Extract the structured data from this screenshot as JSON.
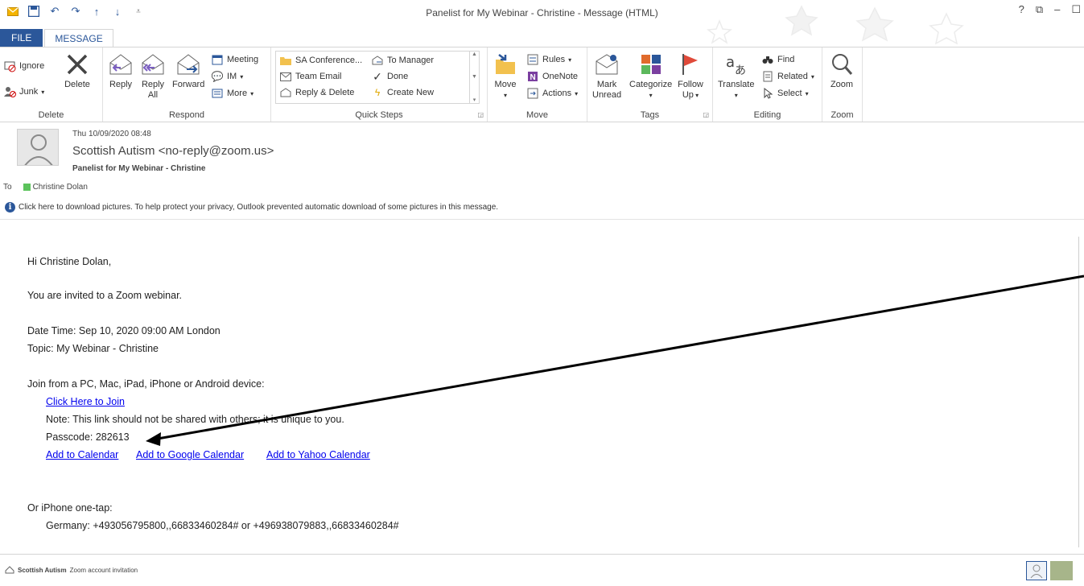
{
  "window": {
    "title": "Panelist for My Webinar - Christine - Message (HTML)",
    "controls": [
      "?",
      "⧉",
      "–",
      "☐"
    ]
  },
  "tabs": [
    "FILE",
    "MESSAGE"
  ],
  "ribbon": {
    "delete": {
      "ignore": "Ignore",
      "junk": "Junk",
      "delete": "Delete",
      "label": "Delete"
    },
    "respond": {
      "reply": "Reply",
      "reply_all_1": "Reply",
      "reply_all_2": "All",
      "forward": "Forward",
      "meeting": "Meeting",
      "im": "IM",
      "more": "More",
      "label": "Respond"
    },
    "quick_steps": {
      "items": [
        "SA Conference...",
        "Team Email",
        "Reply & Delete",
        "To Manager",
        "Done",
        "Create New"
      ],
      "label": "Quick Steps"
    },
    "move": {
      "move": "Move",
      "rules": "Rules",
      "onenote": "OneNote",
      "actions": "Actions",
      "label": "Move"
    },
    "tags": {
      "mark_unread_1": "Mark",
      "mark_unread_2": "Unread",
      "categorize": "Categorize",
      "follow_up_1": "Follow",
      "follow_up_2": "Up",
      "label": "Tags"
    },
    "editing": {
      "translate": "Translate",
      "find": "Find",
      "related": "Related",
      "select": "Select",
      "label": "Editing"
    },
    "zoom": {
      "zoom": "Zoom",
      "label": "Zoom"
    }
  },
  "message": {
    "date": "Thu 10/09/2020 08:48",
    "from": "Scottish Autism <no-reply@zoom.us>",
    "subject": "Panelist for My Webinar - Christine",
    "to_label": "To",
    "to": "Christine Dolan",
    "infobar": "Click here to download pictures. To help protect your privacy, Outlook prevented automatic download of some pictures in this message."
  },
  "body": {
    "greeting": "Hi Christine Dolan,",
    "invite": "You are invited to a Zoom webinar.",
    "datetime": "Date Time: Sep 10, 2020 09:00 AM London",
    "topic": "Topic: My Webinar - Christine",
    "join_intro": "Join from a PC, Mac, iPad, iPhone or Android device:",
    "join_link": "Click Here to Join",
    "note": "Note: This link should not be shared with others; it is unique to you.",
    "passcode": "Passcode: 282613",
    "cal_links": [
      "Add to Calendar",
      "Add to Google Calendar",
      "Add to Yahoo Calendar"
    ],
    "iphone": "Or iPhone one-tap:",
    "germany": "Germany: +493056795800,,66833460284# or +496938079883,,66833460284#"
  },
  "statusbar": {
    "sender": "Scottish Autism",
    "text": "Zoom account invitation"
  },
  "colors": {
    "accent": "#2b579a",
    "link": "#0000ee",
    "presence": "#5cc35c"
  }
}
